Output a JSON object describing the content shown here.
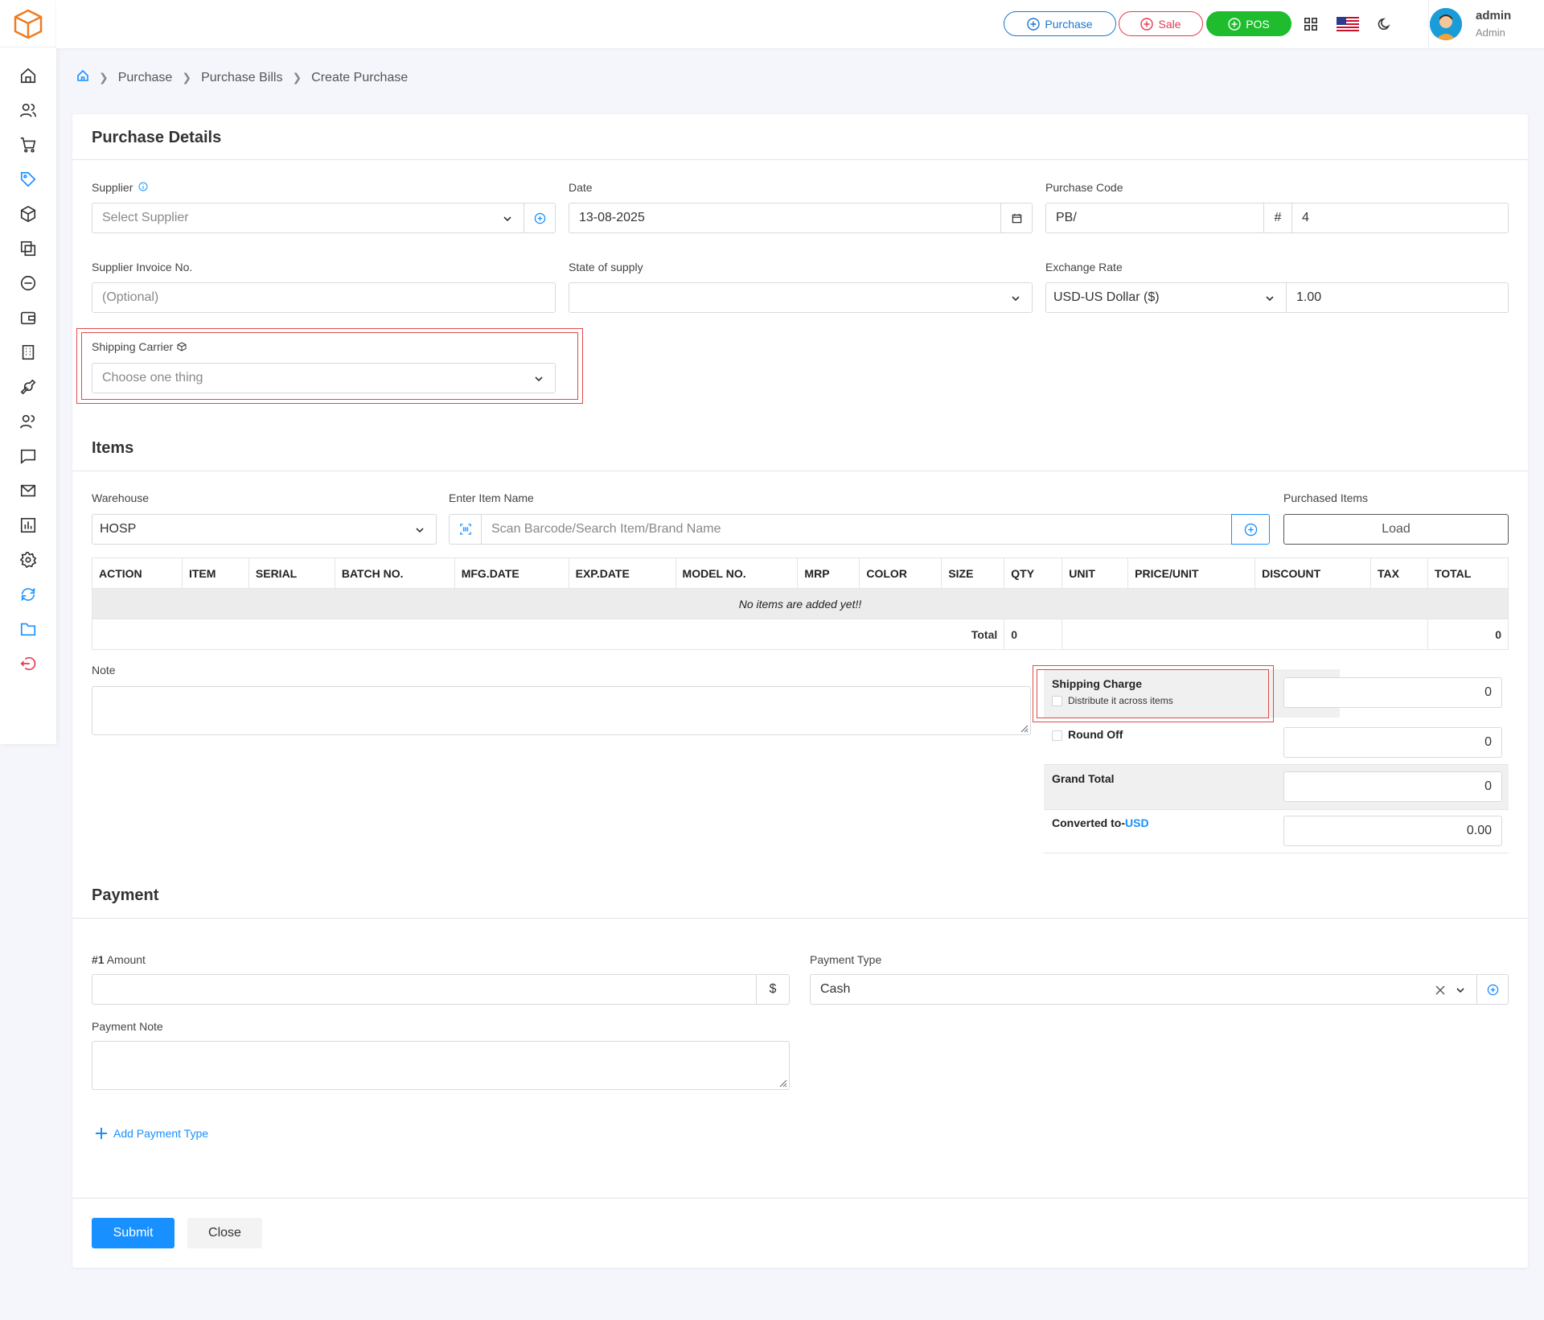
{
  "topbar": {
    "purchase_label": "Purchase",
    "sale_label": "Sale",
    "pos_label": "POS",
    "user_name": "admin",
    "user_role": "Admin"
  },
  "breadcrumb": {
    "items": [
      "Purchase",
      "Purchase Bills",
      "Create Purchase"
    ]
  },
  "purchase_details": {
    "title": "Purchase Details",
    "supplier_label": "Supplier",
    "supplier_placeholder": "Select Supplier",
    "date_label": "Date",
    "date_value": "13-08-2025",
    "purchase_code_label": "Purchase Code",
    "purchase_code_prefix": "PB/",
    "purchase_code_hash": "#",
    "purchase_code_number": "4",
    "supplier_invoice_label": "Supplier Invoice No.",
    "supplier_invoice_placeholder": "(Optional)",
    "state_label": "State of supply",
    "state_value": "",
    "exchange_rate_label": "Exchange Rate",
    "currency_value": "USD-US Dollar ($)",
    "rate_value": "1.00",
    "shipping_carrier_label": "Shipping Carrier",
    "shipping_carrier_placeholder": "Choose one thing"
  },
  "items_section": {
    "title": "Items",
    "warehouse_label": "Warehouse",
    "warehouse_value": "HOSP",
    "item_name_label": "Enter Item Name",
    "item_search_placeholder": "Scan Barcode/Search Item/Brand Name",
    "purchased_items_label": "Purchased Items",
    "load_label": "Load",
    "columns": [
      "ACTION",
      "ITEM",
      "SERIAL",
      "BATCH NO.",
      "MFG.DATE",
      "EXP.DATE",
      "MODEL NO.",
      "MRP",
      "COLOR",
      "SIZE",
      "QTY",
      "UNIT",
      "PRICE/UNIT",
      "DISCOUNT",
      "TAX",
      "TOTAL"
    ],
    "empty_message": "No items are added yet!!",
    "total_label": "Total",
    "total_qty": "0",
    "total_amount": "0"
  },
  "summary": {
    "note_label": "Note",
    "shipping_charge_label": "Shipping Charge",
    "distribute_label": "Distribute it across items",
    "shipping_charge_value": "0",
    "round_off_label": "Round Off",
    "round_off_value": "0",
    "grand_total_label": "Grand Total",
    "grand_total_value": "0",
    "converted_label": "Converted to-",
    "converted_currency": "USD",
    "converted_value": "0.00"
  },
  "payment": {
    "title": "Payment",
    "amount_number": "#1",
    "amount_label": "Amount",
    "amount_value": "",
    "currency_symbol": "$",
    "payment_type_label": "Payment Type",
    "payment_type_value": "Cash",
    "payment_note_label": "Payment Note",
    "add_payment_label": "Add Payment Type"
  },
  "actions": {
    "submit_label": "Submit",
    "close_label": "Close"
  },
  "colors": {
    "primary": "#1890ff",
    "sale": "#e53950",
    "pos": "#1fbd2e",
    "logo": "#f07b22",
    "highlight_border": "#e04a4a"
  }
}
